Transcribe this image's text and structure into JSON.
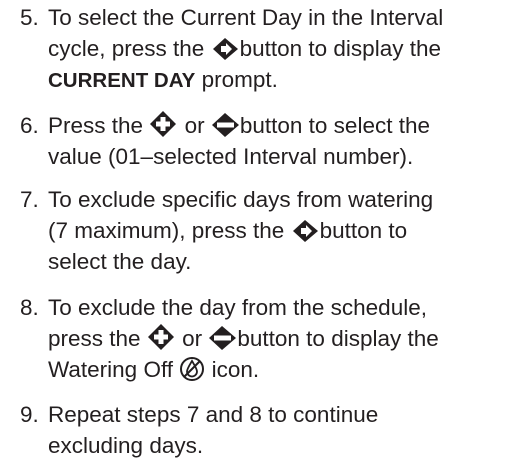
{
  "steps": [
    {
      "number": "5.",
      "text": {
        "l1": "To select the Current Day in the Interval",
        "l2a": "cycle, press the",
        "l2b": "button to display the",
        "l3_bold": "CURRENT DAY",
        "l3_rest": " prompt."
      },
      "icons": [
        "right-arrow-button-icon"
      ]
    },
    {
      "number": "6.",
      "text": {
        "l1a": "Press the",
        "l1b": "or",
        "l1c": "button to select the",
        "l2": "value (01–selected Interval number)."
      },
      "icons": [
        "plus-button-icon",
        "minus-button-icon"
      ]
    },
    {
      "number": "7.",
      "text": {
        "l1": "To exclude specific days from watering",
        "l2a": "(7 maximum), press the",
        "l2b": "button to",
        "l3": "select the day."
      },
      "icons": [
        "right-arrow-button-icon"
      ]
    },
    {
      "number": "8.",
      "text": {
        "l1": "To exclude the day from the schedule,",
        "l2a": "press the",
        "l2b": "or",
        "l2c": "button to display the",
        "l3a": "Watering Off",
        "l3b": "icon."
      },
      "icons": [
        "plus-button-icon",
        "minus-button-icon",
        "watering-off-icon"
      ]
    },
    {
      "number": "9.",
      "text": {
        "l1": "Repeat steps 7 and 8 to continue",
        "l2": "excluding days."
      }
    }
  ],
  "colors": {
    "text": "#231f20",
    "icon": "#231f20",
    "background": "#ffffff"
  }
}
